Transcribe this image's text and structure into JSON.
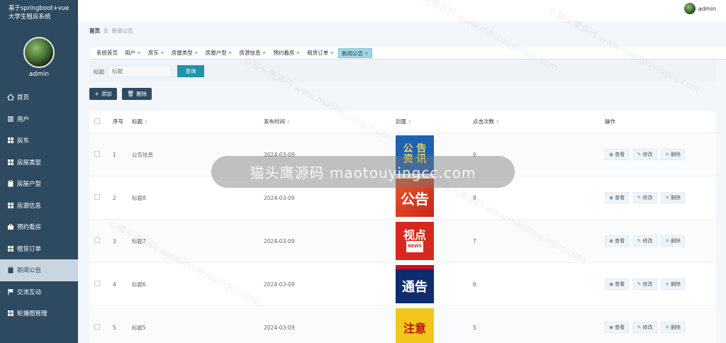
{
  "sidebar": {
    "system_title": "基于springboot+vue大学生租房系统",
    "admin_name": "admin",
    "items": [
      {
        "label": "首页",
        "icon": "home-icon"
      },
      {
        "label": "用户",
        "icon": "list-icon"
      },
      {
        "label": "房东",
        "icon": "grid-icon"
      },
      {
        "label": "房屋类型",
        "icon": "grid-icon"
      },
      {
        "label": "房屋户型",
        "icon": "clipboard-icon"
      },
      {
        "label": "房源信息",
        "icon": "grid-icon"
      },
      {
        "label": "预约看房",
        "icon": "briefcase-icon"
      },
      {
        "label": "租赁订单",
        "icon": "grid-icon"
      },
      {
        "label": "新闻公告",
        "icon": "clipboard-icon",
        "active": true
      },
      {
        "label": "交流互动",
        "icon": "flag-icon"
      },
      {
        "label": "轮播图管理",
        "icon": "grid-icon"
      }
    ]
  },
  "topbar": {
    "user": "admin"
  },
  "breadcrumb": {
    "home": "首页",
    "current": "新闻公告"
  },
  "tags": [
    "系统首页",
    "用户",
    "房东",
    "房屋类型",
    "房屋户型",
    "房源信息",
    "预约看房",
    "租赁订单",
    "新闻公告"
  ],
  "search": {
    "label": "标题",
    "placeholder": "标题",
    "button": "查询"
  },
  "toolbar": {
    "add": "添加",
    "delete": "删除"
  },
  "table": {
    "headers": {
      "no": "序号",
      "title": "标题",
      "time": "发布时间",
      "cover": "封面",
      "clicks": "点击次数",
      "ops": "操作"
    },
    "rows": [
      {
        "no": "1",
        "title": "公告信息",
        "time": "2024-03-09",
        "clicks": "0",
        "cover_line1": "公 告",
        "cover_line2": "资 讯"
      },
      {
        "no": "2",
        "title": "标题8",
        "time": "2024-03-09",
        "clicks": "8",
        "cover_line1": "公告",
        "cover_line2": ""
      },
      {
        "no": "3",
        "title": "标题7",
        "time": "2024-03-09",
        "clicks": "7",
        "cover_line1": "视点",
        "cover_line2": "NEWS"
      },
      {
        "no": "4",
        "title": "标题6",
        "time": "2024-03-09",
        "clicks": "6",
        "cover_line1": "通告",
        "cover_line2": ""
      },
      {
        "no": "5",
        "title": "标题5",
        "time": "2024-03-09",
        "clicks": "5",
        "cover_line1": "注意",
        "cover_line2": ""
      }
    ],
    "ops": {
      "view": "查看",
      "edit": "修改",
      "delete": "删除"
    }
  },
  "watermark": {
    "pill": "猫头鹰源码 maotouyingcc.com",
    "text": "©猫头鹰源码 www.maotouyingcc.com"
  }
}
